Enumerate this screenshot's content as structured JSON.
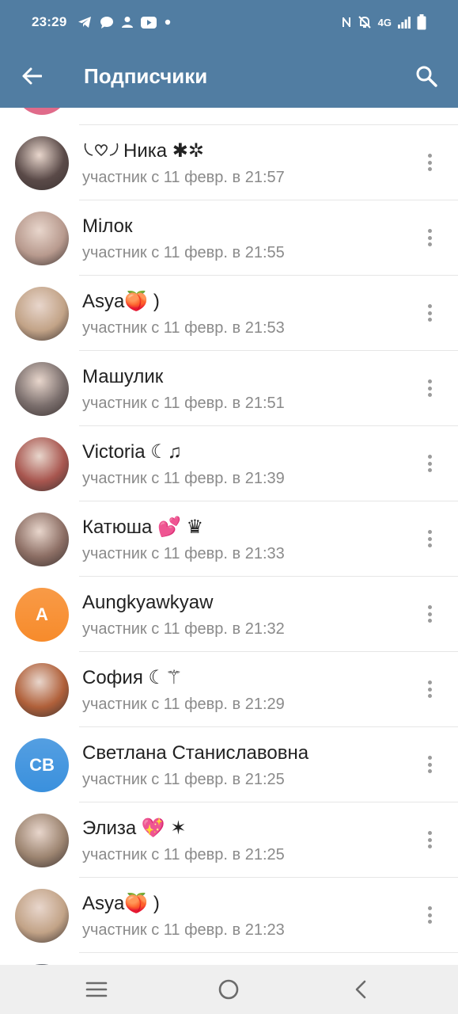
{
  "statusbar": {
    "time": "23:29",
    "network": "4G",
    "left_icons": [
      "telegram-icon",
      "chat-icon",
      "person-icon",
      "youtube-icon",
      "dot-icon"
    ],
    "right_icons": [
      "nfc-icon",
      "bell-off-icon",
      "signal-icon",
      "battery-icon"
    ]
  },
  "appbar": {
    "title": "Подписчики",
    "back_icon": "arrow-left-icon",
    "search_icon": "search-icon"
  },
  "members": [
    {
      "name": "Ника ✱✲",
      "prefix_icon": "wings-heart-icon",
      "status": "участник с 11 февр. в 21:57",
      "avatar_type": "photo",
      "avatar_color": "#5a4a48"
    },
    {
      "name": "Мілок",
      "status": "участник с 11 февр. в 21:55",
      "avatar_type": "photo",
      "avatar_color": "#b89a8e"
    },
    {
      "name": "Asya🍑 )",
      "status": "участник с 11 февр. в 21:53",
      "avatar_type": "photo",
      "avatar_color": "#c2a387"
    },
    {
      "name": "Машулик",
      "status": "участник с 11 февр. в 21:51",
      "avatar_type": "photo",
      "avatar_color": "#7a6e6c"
    },
    {
      "name": "Victoria ☾♫",
      "status": "участник с 11 февр. в 21:39",
      "avatar_type": "photo",
      "avatar_color": "#a8564f"
    },
    {
      "name": "Катюша 💕 ♛",
      "status": "участник с 11 февр. в 21:33",
      "avatar_type": "photo",
      "avatar_color": "#8c6e64"
    },
    {
      "name": "Aungkyawkyaw",
      "status": "участник с 11 февр. в 21:32",
      "avatar_type": "initials",
      "initials": "A",
      "avatar_color": "#f78b2b"
    },
    {
      "name": "София ☾⚚",
      "status": "участник с 11 февр. в 21:29",
      "avatar_type": "photo",
      "avatar_color": "#b0603a"
    },
    {
      "name": "Светлана Станиславовна",
      "status": "участник с 11 февр. в 21:25",
      "avatar_type": "initials",
      "initials": "СВ",
      "avatar_color": "#3a90dd"
    },
    {
      "name": "Элиза 💖 ✶",
      "status": "участник с 11 февр. в 21:25",
      "avatar_type": "photo",
      "avatar_color": "#9c8470"
    },
    {
      "name": "Asya🍑 )",
      "status": "участник с 11 февр. в 21:23",
      "avatar_type": "photo",
      "avatar_color": "#c2a387"
    }
  ],
  "navbar": {
    "recents_icon": "recents-icon",
    "home_icon": "home-icon",
    "back_icon": "back-chevron-icon"
  },
  "colors": {
    "header": "#517da2",
    "name_text": "#222222",
    "status_text": "#8a8a8a",
    "divider": "#e6e6e6",
    "navbar": "#efefef"
  }
}
